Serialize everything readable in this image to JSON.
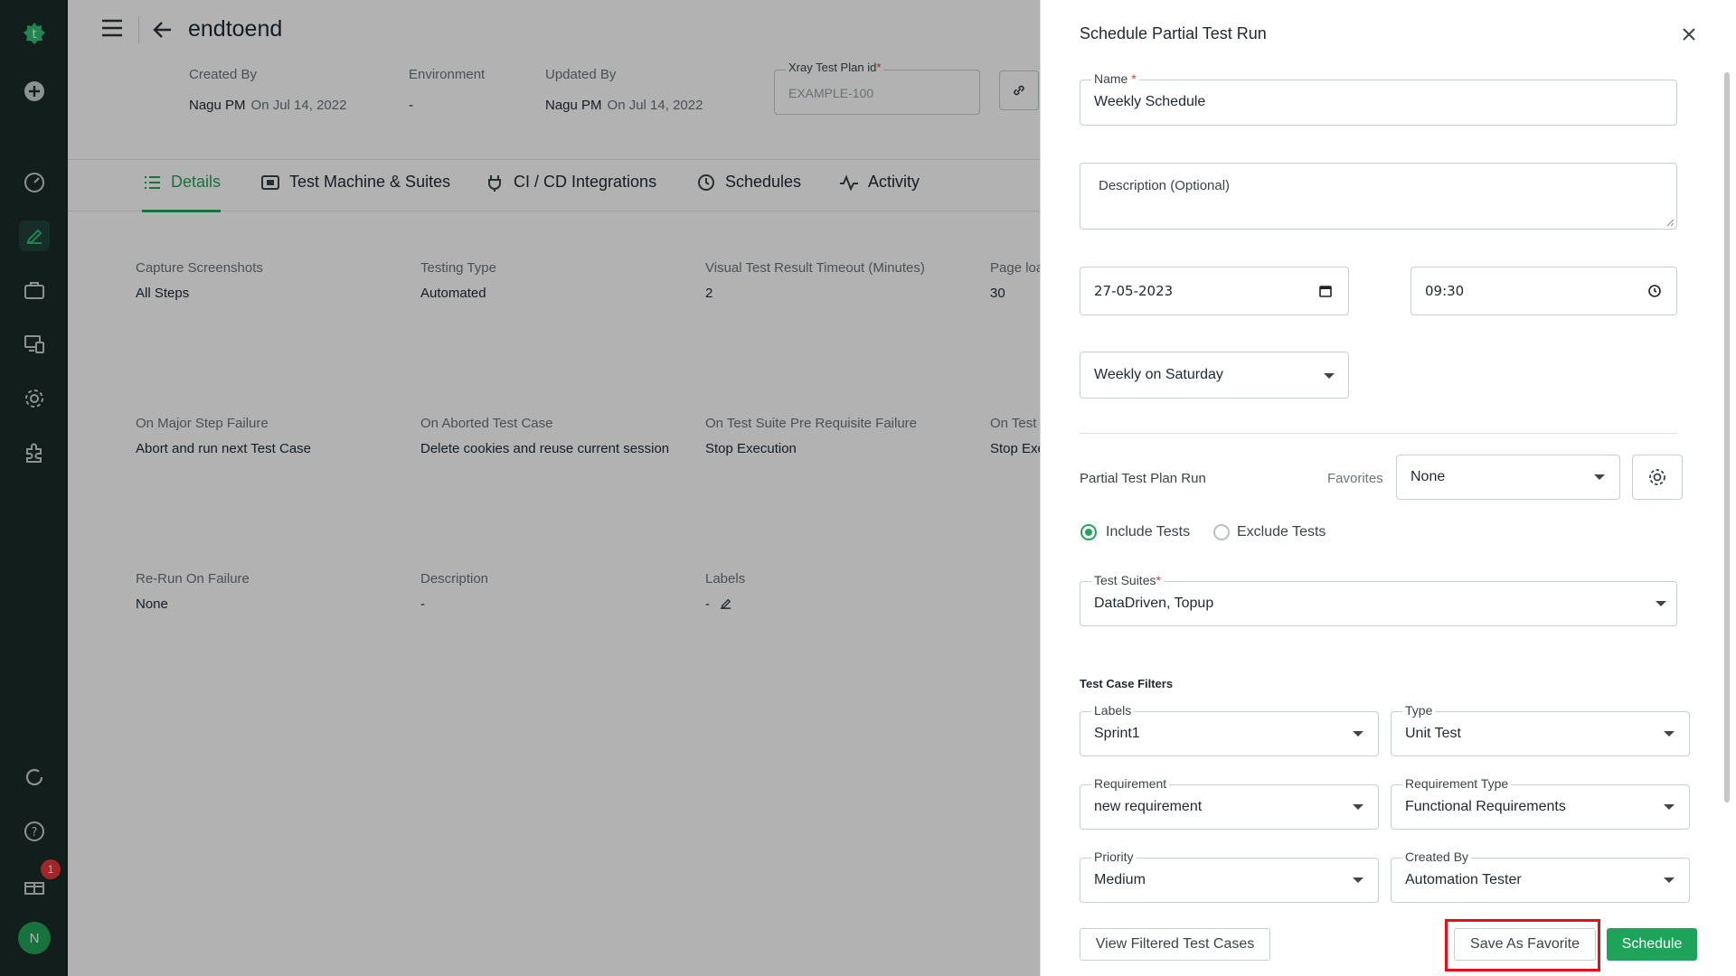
{
  "sidebar": {
    "notification_count": "1",
    "avatar_initial": "N"
  },
  "header": {
    "title": "endtoend",
    "created_by_label": "Created By",
    "created_by_name": "Nagu PM",
    "created_on": "On Jul 14, 2022",
    "environment_label": "Environment",
    "environment_value": "-",
    "updated_by_label": "Updated By",
    "updated_by_name": "Nagu PM",
    "updated_on": "On Jul 14, 2022",
    "xray_label": "Xray Test Plan id",
    "xray_required": "*",
    "xray_placeholder": "EXAMPLE-100"
  },
  "tabs": [
    {
      "label": "Details",
      "icon": "list-icon"
    },
    {
      "label": "Test Machine & Suites",
      "icon": "machine-icon"
    },
    {
      "label": "CI / CD Integrations",
      "icon": "plug-icon"
    },
    {
      "label": "Schedules",
      "icon": "clock-icon"
    },
    {
      "label": "Activity",
      "icon": "activity-icon"
    }
  ],
  "details": [
    {
      "label": "Capture Screenshots",
      "value": "All Steps"
    },
    {
      "label": "Testing Type",
      "value": "Automated"
    },
    {
      "label": "Visual Test Result Timeout (Minutes)",
      "value": "2"
    },
    {
      "label": "Page loa",
      "value": "30"
    },
    {
      "label": "On Major Step Failure",
      "value": "Abort and run next Test Case"
    },
    {
      "label": "On Aborted Test Case",
      "value": "Delete cookies and reuse current session"
    },
    {
      "label": "On Test Suite Pre Requisite Failure",
      "value": "Stop Execution"
    },
    {
      "label": "On Test (",
      "value": "Stop Exe"
    },
    {
      "label": "Re-Run On Failure",
      "value": "None"
    },
    {
      "label": "Description",
      "value": "-"
    },
    {
      "label": "Labels",
      "value": "-"
    }
  ],
  "drawer": {
    "title": "Schedule Partial Test Run",
    "name_label": "Name",
    "name_required": "*",
    "name_value": "Weekly Schedule",
    "description_placeholder": "Description (Optional)",
    "date_value": "27-05-2023",
    "time_value": "09:30",
    "recurrence_value": "Weekly on Saturday",
    "partial_label": "Partial Test Plan Run",
    "favorites_label": "Favorites",
    "favorites_value": "None",
    "include_label": "Include Tests",
    "exclude_label": "Exclude Tests",
    "include_selected": true,
    "suites_label": "Test Suites",
    "suites_required": "*",
    "suites_value": "DataDriven, Topup",
    "filters_heading": "Test Case Filters",
    "filters": {
      "labels": {
        "label": "Labels",
        "value": "Sprint1"
      },
      "type": {
        "label": "Type",
        "value": "Unit Test"
      },
      "requirement": {
        "label": "Requirement",
        "value": "new requirement"
      },
      "requirement_type": {
        "label": "Requirement Type",
        "value": "Functional Requirements"
      },
      "priority": {
        "label": "Priority",
        "value": "Medium"
      },
      "created_by": {
        "label": "Created By",
        "value": "Automation Tester"
      }
    },
    "view_filtered_label": "View Filtered Test Cases",
    "save_favorite_label": "Save As Favorite",
    "schedule_label": "Schedule"
  },
  "colors": {
    "accent": "#23a45a",
    "sidebar_bg": "#1b2b27",
    "highlight": "#e3101a"
  }
}
